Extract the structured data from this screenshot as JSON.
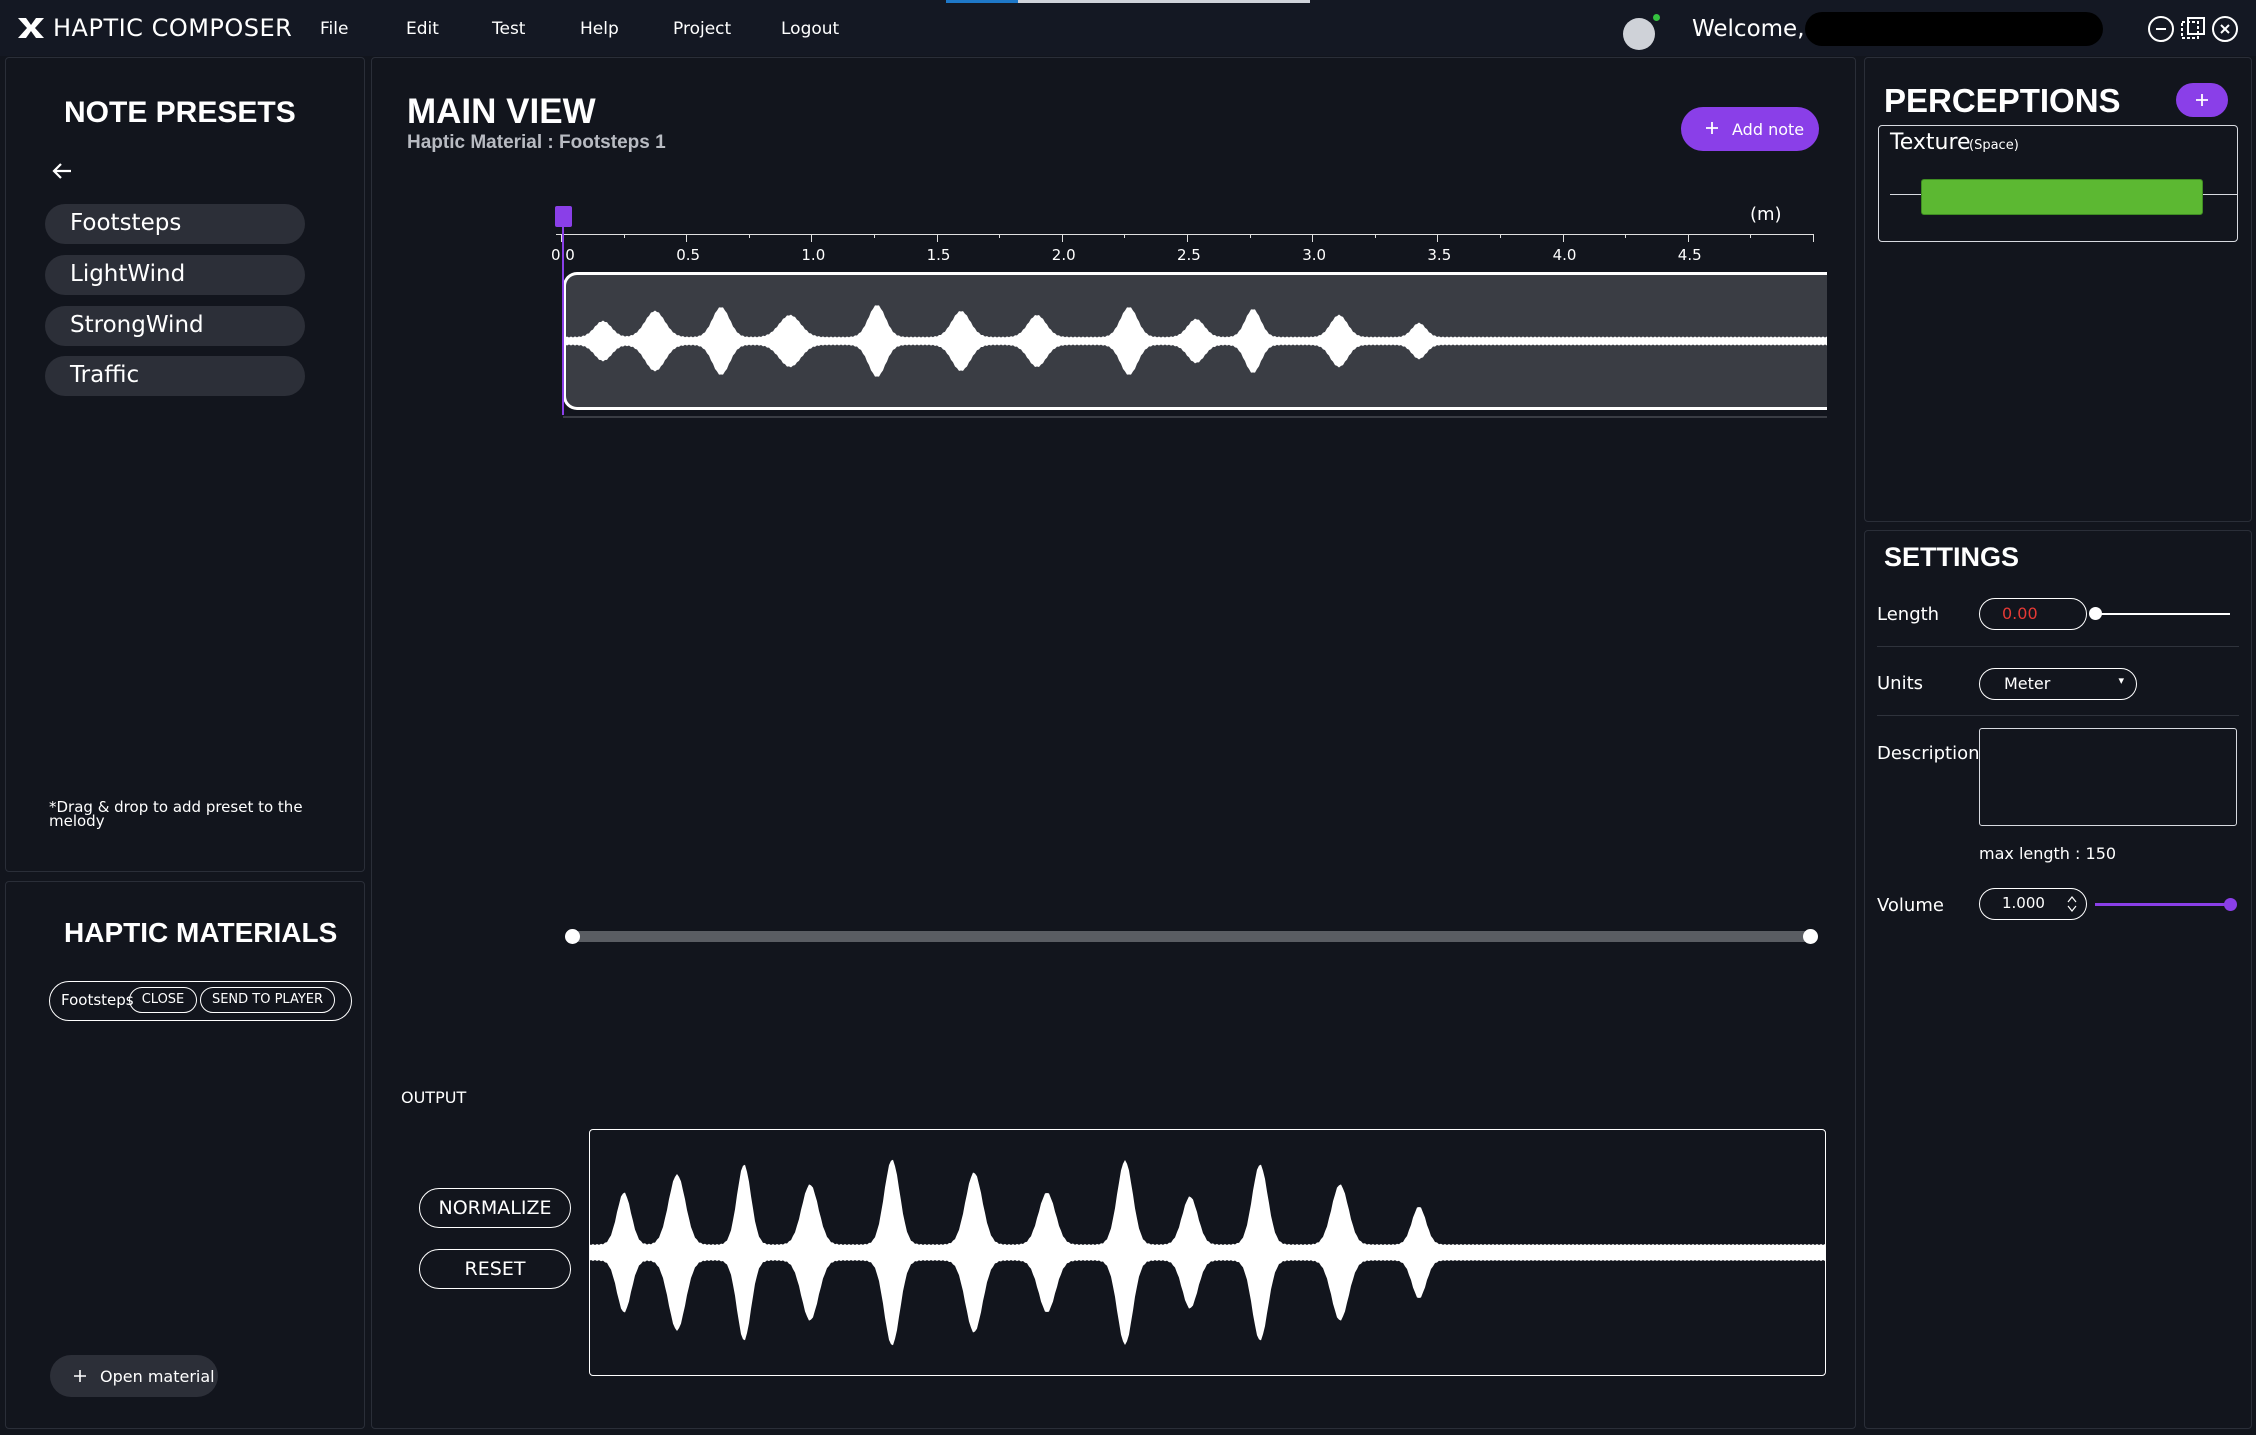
{
  "app": {
    "name": "HAPTIC COMPOSER"
  },
  "menu": [
    "File",
    "Edit",
    "Test",
    "Help",
    "Project",
    "Logout"
  ],
  "user": {
    "welcome": "Welcome,"
  },
  "window_controls": [
    "minimize-icon",
    "restore-icon",
    "close-icon"
  ],
  "note_presets": {
    "title": "NOTE PRESETS",
    "items": [
      "Footsteps",
      "LightWind",
      "StrongWind",
      "Traffic"
    ],
    "hint": "*Drag & drop to add preset to the melody"
  },
  "haptic_materials": {
    "title": "HAPTIC MATERIALS",
    "open_item": {
      "name": "Footsteps",
      "close_label": "CLOSE",
      "send_label": "SEND TO PLAYER"
    },
    "open_material_label": "Open material"
  },
  "main_view": {
    "title": "MAIN VIEW",
    "subtitle": "Haptic Material : Footsteps 1",
    "add_note_label": "Add note",
    "ruler": {
      "unit": "(m)",
      "ticks": [
        "0.0",
        "0.5",
        "1.0",
        "1.5",
        "2.0",
        "2.5",
        "3.0",
        "3.5",
        "4.0",
        "4.5"
      ]
    },
    "playhead": 0.0,
    "output_label": "OUTPUT",
    "normalize_label": "NORMALIZE",
    "reset_label": "RESET"
  },
  "perceptions": {
    "title": "PERCEPTIONS",
    "add_icon": "plus-icon",
    "items": [
      {
        "name": "Texture",
        "tag": "(Space)",
        "color": "#5cb832"
      }
    ]
  },
  "settings": {
    "title": "SETTINGS",
    "length_label": "Length",
    "length_value": "0.00",
    "length_value_color": "#e53935",
    "units_label": "Units",
    "units_value": "Meter",
    "description_label": "Description",
    "description_value": "",
    "max_length_text": "max length : 150",
    "volume_label": "Volume",
    "volume_value": "1.000",
    "volume_level": 1.0
  },
  "colors": {
    "accent": "#8a3fe8",
    "background": "#12151d",
    "texture_bar": "#5cb832"
  }
}
